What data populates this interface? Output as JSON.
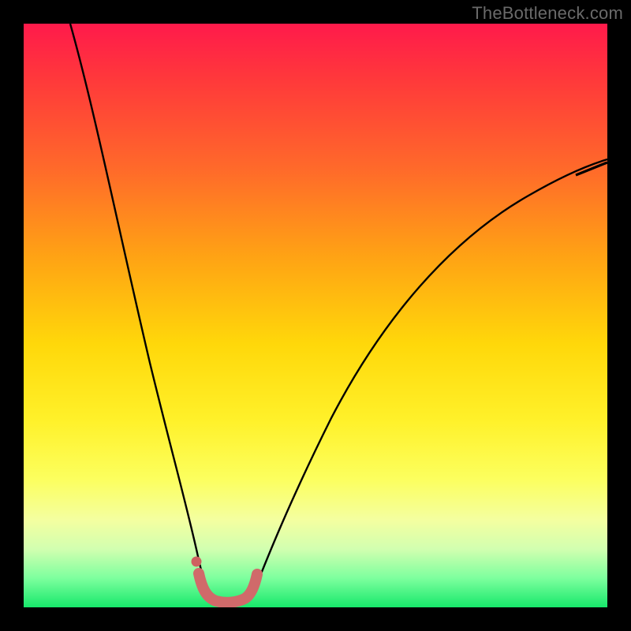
{
  "watermark": "TheBottleneck.com",
  "colors": {
    "frame": "#000000",
    "curve": "#000000",
    "marker": "#d06a6a",
    "marker_dot": "#cf6060"
  },
  "chart_data": {
    "type": "line",
    "title": "",
    "xlabel": "",
    "ylabel": "",
    "xlim": [
      0,
      100
    ],
    "ylim": [
      0,
      100
    ],
    "series": [
      {
        "name": "left-branch",
        "x": [
          8,
          10,
          12,
          14,
          16,
          18,
          20,
          22,
          24,
          26,
          28,
          29.5,
          31
        ],
        "y": [
          100,
          90,
          79,
          67,
          56,
          45,
          35,
          26,
          18,
          11,
          6,
          3,
          1.5
        ]
      },
      {
        "name": "right-branch",
        "x": [
          38,
          40,
          44,
          48,
          52,
          56,
          60,
          65,
          70,
          76,
          82,
          88,
          94,
          100
        ],
        "y": [
          1.5,
          3,
          8,
          14,
          21,
          28,
          35,
          43,
          50,
          57,
          63,
          68,
          72,
          75
        ]
      },
      {
        "name": "valley-marker",
        "x": [
          29.5,
          30,
          31,
          32.5,
          34.5,
          36,
          37.5,
          38.5,
          39
        ],
        "y": [
          4,
          2.2,
          1.2,
          0.8,
          0.8,
          1.0,
          1.6,
          3,
          5
        ]
      }
    ],
    "annotations": [
      {
        "type": "dot",
        "x": 29.5,
        "y": 7.8
      }
    ]
  }
}
